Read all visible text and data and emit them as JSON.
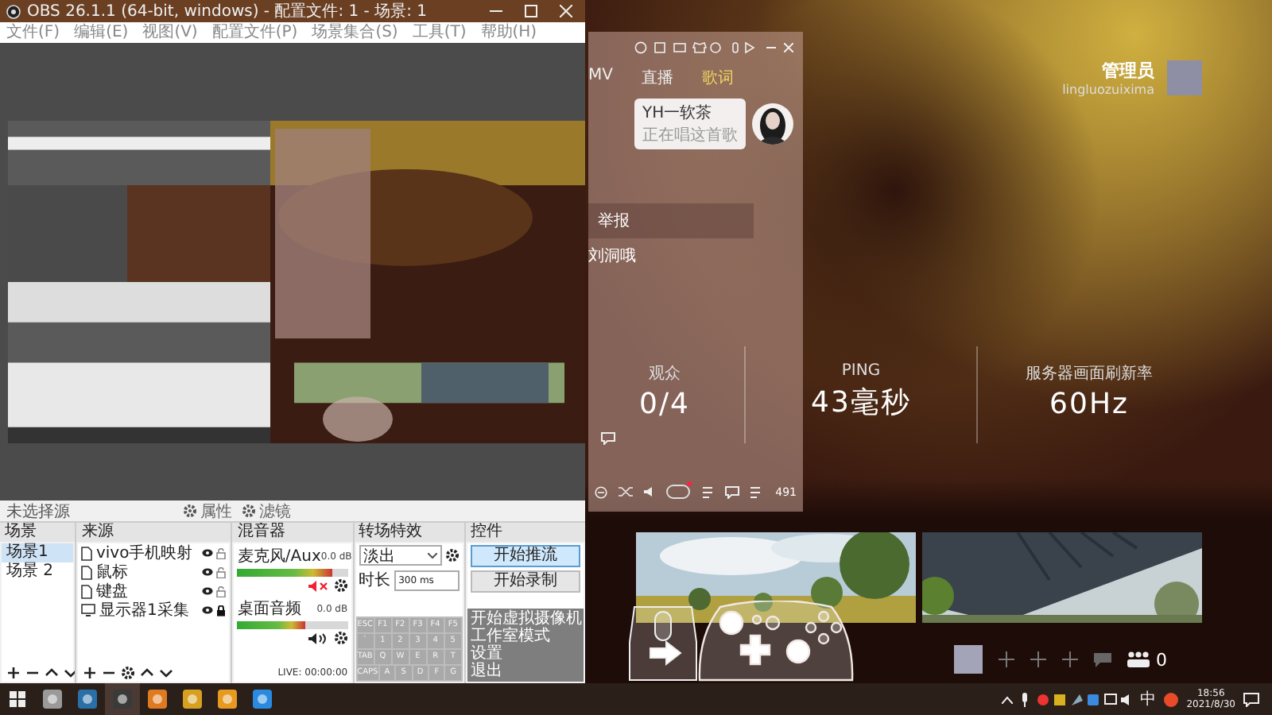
{
  "obs": {
    "title": "OBS 26.1.1 (64-bit, windows) - 配置文件: 1 - 场景: 1",
    "menu": [
      "文件(F)",
      "编辑(E)",
      "视图(V)",
      "配置文件(P)",
      "场景集合(S)",
      "工具(T)",
      "帮助(H)"
    ],
    "toolbar": {
      "source": "未选择源",
      "buttons": [
        "属性",
        "滤镜"
      ]
    },
    "scenes": {
      "title": "场景",
      "items": [
        {
          "label": "场景1",
          "selected": true
        },
        {
          "label": "场景 2",
          "selected": false
        }
      ]
    },
    "sources": {
      "title": "来源",
      "items": [
        {
          "label": "vivo手机映射",
          "kind": "file",
          "locked": false
        },
        {
          "label": "鼠标",
          "kind": "file",
          "locked": false
        },
        {
          "label": "键盘",
          "kind": "file",
          "locked": false
        },
        {
          "label": "显示器1采集",
          "kind": "display",
          "locked": true
        }
      ]
    },
    "mixer": {
      "title": "混音器",
      "channels": [
        {
          "name": "麦克风/Aux",
          "reading": "0.0 dB",
          "level": 0.86,
          "muted": true
        },
        {
          "name": "桌面音频",
          "reading": "0.0 dB",
          "level": 0.62,
          "muted": false
        }
      ]
    },
    "transitions": {
      "title": "转场特效",
      "effect": "淡出",
      "duration_label": "时长",
      "duration": "300 ms"
    },
    "controls": {
      "title": "控件",
      "buttons": [
        {
          "label": "开始推流",
          "selected": true
        },
        {
          "label": "开始录制",
          "selected": false
        }
      ]
    },
    "menu_overlay": [
      "开始虚拟摄像机",
      "工作室模式",
      "设置",
      "退出"
    ],
    "keyboard": [
      [
        "ESC",
        "F1",
        "F2",
        "F3",
        "F4",
        "F5"
      ],
      [
        "`",
        "1",
        "2",
        "3",
        "4",
        "5"
      ],
      [
        "TAB",
        "Q",
        "W",
        "E",
        "R",
        "T"
      ],
      [
        "CAPS",
        "A",
        "S",
        "D",
        "F",
        "G"
      ]
    ],
    "status": "LIVE: 00:00:00"
  },
  "game": {
    "player": {
      "tabs": [
        {
          "label": "MV",
          "selected": false
        },
        {
          "label": "直播",
          "selected": false
        },
        {
          "label": "歌词",
          "selected": true
        }
      ],
      "bubble": {
        "name": "YH一软茶",
        "status": "正在唱这首歌"
      },
      "report": "举报",
      "line": "刘洞哦",
      "count": "491"
    },
    "user": {
      "role": "管理员",
      "name": "lingluozuixima"
    },
    "stats": [
      {
        "label": "观众",
        "value": "0/4"
      },
      {
        "label": "PING",
        "value": "43毫秒"
      },
      {
        "label": "服务器画面刷新率",
        "value": "60Hz"
      }
    ],
    "friends": {
      "count": "0"
    }
  },
  "taskbar": {
    "ime": "中",
    "time": "18:56",
    "date": "2021/8/30"
  }
}
